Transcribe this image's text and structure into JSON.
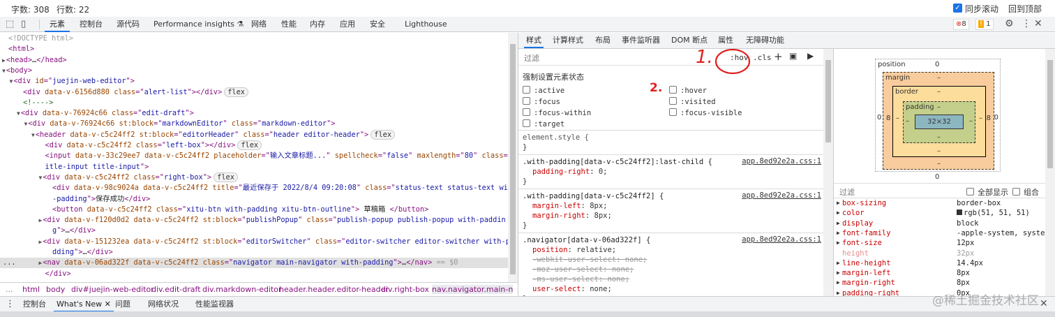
{
  "topbar": {
    "word_count": "字数: 308",
    "line_count": "行数: 22",
    "sync_scroll": "同步滚动",
    "sync_checked": true,
    "back_to_top": "回到顶部"
  },
  "devtools": {
    "tabs": [
      "元素",
      "控制台",
      "源代码",
      "Performance insights",
      "网络",
      "性能",
      "内存",
      "应用",
      "安全",
      "Lighthouse"
    ],
    "active_tab": "元素",
    "errors": "8",
    "warnings": "1",
    "accent": "#1a73e8"
  },
  "elements": {
    "lines": [
      [
        [
          "dt",
          "<!DOCTYPE html>"
        ]
      ],
      [
        [
          "tag",
          "<html>"
        ]
      ],
      [
        [
          "tri",
          "▶"
        ],
        [
          "tag",
          "<head>"
        ],
        [
          "tx",
          "…"
        ],
        [
          "tag",
          "</head>"
        ]
      ],
      [
        [
          "tri",
          "▼"
        ],
        [
          "tag",
          "<body>"
        ]
      ],
      [
        [
          "tri",
          "▼"
        ],
        [
          "tag",
          "<div "
        ],
        [
          "an",
          "id"
        ],
        [
          "tag",
          "=\""
        ],
        [
          "av",
          "juejin-web-editor"
        ],
        [
          "tag",
          "\">"
        ]
      ],
      [
        [
          "tag",
          "<div "
        ],
        [
          "an",
          "data-v-6156d880 class"
        ],
        [
          "tag",
          "=\""
        ],
        [
          "av",
          "alert-list"
        ],
        [
          "tag",
          "\"></div>"
        ],
        [
          "badge",
          "flex"
        ]
      ],
      [
        [
          "cm",
          "<!---->"
        ]
      ],
      [
        [
          "tri",
          "▼"
        ],
        [
          "tag",
          "<div "
        ],
        [
          "an",
          "data-v-76924c66 class"
        ],
        [
          "tag",
          "=\""
        ],
        [
          "av",
          "edit-draft"
        ],
        [
          "tag",
          "\">"
        ]
      ],
      [
        [
          "tri",
          "▼"
        ],
        [
          "tag",
          "<div "
        ],
        [
          "an",
          "data-v-76924c66 st:block"
        ],
        [
          "tag",
          "=\""
        ],
        [
          "av",
          "markdownEditor"
        ],
        [
          "tag",
          "\" "
        ],
        [
          "an",
          "class"
        ],
        [
          "tag",
          "=\""
        ],
        [
          "av",
          "markdown-editor"
        ],
        [
          "tag",
          "\">"
        ]
      ],
      [
        [
          "tri",
          "▼"
        ],
        [
          "tag",
          "<header "
        ],
        [
          "an",
          "data-v-c5c24ff2 st:block"
        ],
        [
          "tag",
          "=\""
        ],
        [
          "av",
          "editorHeader"
        ],
        [
          "tag",
          "\" "
        ],
        [
          "an",
          "class"
        ],
        [
          "tag",
          "=\""
        ],
        [
          "av",
          "header editor-header"
        ],
        [
          "tag",
          "\">"
        ],
        [
          "badge",
          "flex"
        ]
      ],
      [
        [
          "tag",
          "<div "
        ],
        [
          "an",
          "data-v-c5c24ff2 class"
        ],
        [
          "tag",
          "=\""
        ],
        [
          "av",
          "left-box"
        ],
        [
          "tag",
          "\"></div>"
        ],
        [
          "badge",
          "flex"
        ]
      ],
      [
        [
          "tag",
          "<input "
        ],
        [
          "an",
          "data-v-33c29ee7 data-v-c5c24ff2 placeholder"
        ],
        [
          "tag",
          "=\""
        ],
        [
          "av",
          "输入文章标题..."
        ],
        [
          "tag",
          "\" "
        ],
        [
          "an",
          "spellcheck"
        ],
        [
          "tag",
          "=\""
        ],
        [
          "av",
          "false"
        ],
        [
          "tag",
          "\" "
        ],
        [
          "an",
          "maxlength"
        ],
        [
          "tag",
          "=\""
        ],
        [
          "av",
          "80"
        ],
        [
          "tag",
          "\" "
        ],
        [
          "an",
          "class"
        ],
        [
          "tag",
          "=\""
        ],
        [
          "av",
          "t"
        ]
      ],
      [
        [
          "av",
          "itle-input title-input"
        ],
        [
          "tag",
          "\">"
        ]
      ],
      [
        [
          "tri",
          "▼"
        ],
        [
          "tag",
          "<div "
        ],
        [
          "an",
          "data-v-c5c24ff2 class"
        ],
        [
          "tag",
          "=\""
        ],
        [
          "av",
          "right-box"
        ],
        [
          "tag",
          "\">"
        ],
        [
          "badge",
          "flex"
        ]
      ],
      [
        [
          "tag",
          "<div "
        ],
        [
          "an",
          "data-v-98c9024a data-v-c5c24ff2 title"
        ],
        [
          "tag",
          "=\""
        ],
        [
          "av",
          "最近保存于 2022/8/4 09:20:08"
        ],
        [
          "tag",
          "\" "
        ],
        [
          "an",
          "class"
        ],
        [
          "tag",
          "=\""
        ],
        [
          "av",
          "status-text status-text with"
        ]
      ],
      [
        [
          "av",
          "-padding"
        ],
        [
          "tag",
          "\">"
        ],
        [
          "tx",
          "保存成功"
        ],
        [
          "tag",
          "</div>"
        ]
      ],
      [
        [
          "tag",
          "<button "
        ],
        [
          "an",
          "data-v-c5c24ff2 class"
        ],
        [
          "tag",
          "=\""
        ],
        [
          "av",
          "xitu-btn with-padding xitu-btn-outline"
        ],
        [
          "tag",
          "\">"
        ],
        [
          "tx",
          " 草稿箱 "
        ],
        [
          "tag",
          "</button>"
        ]
      ],
      [
        [
          "tri",
          "▶"
        ],
        [
          "tag",
          "<div "
        ],
        [
          "an",
          "data-v-f120d0d2 data-v-c5c24ff2 st:block"
        ],
        [
          "tag",
          "=\""
        ],
        [
          "av",
          "publishPopup"
        ],
        [
          "tag",
          "\" "
        ],
        [
          "an",
          "class"
        ],
        [
          "tag",
          "=\""
        ],
        [
          "av",
          "publish-popup publish-popup with-paddin"
        ]
      ],
      [
        [
          "av",
          "g"
        ],
        [
          "tag",
          "\">"
        ],
        [
          "tx",
          "…"
        ],
        [
          "tag",
          "</div>"
        ]
      ],
      [
        [
          "tri",
          "▶"
        ],
        [
          "tag",
          "<div "
        ],
        [
          "an",
          "data-v-151232ea data-v-c5c24ff2 st:block"
        ],
        [
          "tag",
          "=\""
        ],
        [
          "av",
          "editorSwitcher"
        ],
        [
          "tag",
          "\" "
        ],
        [
          "an",
          "class"
        ],
        [
          "tag",
          "=\""
        ],
        [
          "av",
          "editor-switcher editor-switcher with-pa"
        ]
      ],
      [
        [
          "av",
          "dding"
        ],
        [
          "tag",
          "\">"
        ],
        [
          "tx",
          "…"
        ],
        [
          "tag",
          "</div>"
        ]
      ],
      [
        [
          "tri",
          "▶"
        ],
        [
          "tag",
          "<nav "
        ],
        [
          "an",
          "data-v-06ad322f data-v-c5c24ff2 class"
        ],
        [
          "tag",
          "=\""
        ],
        [
          "av",
          "navigator main-navigator with-padding"
        ],
        [
          "tag",
          "\">"
        ],
        [
          "tx",
          "…"
        ],
        [
          "tag",
          "</nav>"
        ],
        [
          "dt",
          " == $0"
        ]
      ],
      [
        [
          "tag",
          "</div>"
        ]
      ]
    ],
    "selected_marker": "..."
  },
  "breadcrumbs": [
    "...",
    "html",
    "body",
    "div#juejin-web-editor",
    "div.edit-draft",
    "div.markdown-editor",
    "header.header.editor-header",
    "div.right-box",
    "nav.navigator.main-n"
  ],
  "drawer": {
    "tabs": [
      "控制台",
      "What's New",
      "问题",
      "网络状况",
      "性能监视器"
    ],
    "active": "What's New"
  },
  "styles": {
    "tabs": [
      "样式",
      "计算样式",
      "布局",
      "事件监听器",
      "DOM 断点",
      "属性",
      "无障碍功能"
    ],
    "filter_placeholder": "过滤",
    "hov": ":hov",
    "cls": ".cls",
    "force_state_title": "强制设置元素状态",
    "states_left": [
      ":active",
      ":focus",
      ":focus-within",
      ":target"
    ],
    "states_right": [
      ":hover",
      ":visited",
      ":focus-visible"
    ],
    "rules": [
      {
        "selector": "element.style {",
        "source": "",
        "props": []
      },
      {
        "selector": ".with-padding[data-v-c5c24ff2]:last-child {",
        "source": "app.8ed92e2a.css:1",
        "props": [
          {
            "name": "padding-right",
            "value": "0;",
            "struck": false
          }
        ]
      },
      {
        "selector": ".with-padding[data-v-c5c24ff2] {",
        "source": "app.8ed92e2a.css:1",
        "props": [
          {
            "name": "margin-left",
            "value": "8px;",
            "struck": false
          },
          {
            "name": "margin-right",
            "value": "8px;",
            "struck": false
          }
        ]
      },
      {
        "selector": ".navigator[data-v-06ad322f] {",
        "source": "app.8ed92e2a.css:1",
        "props": [
          {
            "name": "position",
            "value": "relative;",
            "struck": false
          },
          {
            "name": "-webkit-user-select",
            "value": "none;",
            "struck": true
          },
          {
            "name": "-moz-user-select",
            "value": "none;",
            "struck": true
          },
          {
            "name": "-ms-user-select",
            "value": "none;",
            "struck": true
          },
          {
            "name": "user-select",
            "value": "none;",
            "struck": false
          }
        ]
      }
    ],
    "close_brace": "}"
  },
  "annotations": {
    "step1": "1.",
    "step2": "2.",
    "color": "#e02020"
  },
  "box_model": {
    "position_label": "position",
    "position": "0",
    "margin_label": "margin",
    "margin_top": "–",
    "margin_bottom": "–",
    "margin_left": "8",
    "margin_right": "8",
    "border_label": "border",
    "border_top": "–",
    "border_bottom": "–",
    "border_left": "–",
    "border_right": "–",
    "padding_label": "padding",
    "padding_top": "–",
    "padding_bottom": "–",
    "padding_left": "–",
    "padding_right": "–",
    "content": "32×32",
    "pos_left": "0",
    "pos_right": "0",
    "pos_bottom": "0"
  },
  "computed": {
    "filter_placeholder": "过滤",
    "show_all": "全部显示",
    "group": "组合",
    "props": [
      {
        "name": "box-sizing",
        "value": "border-box"
      },
      {
        "name": "color",
        "value": "rgb(51, 51, 51)",
        "swatch": "#333333"
      },
      {
        "name": "display",
        "value": "block"
      },
      {
        "name": "font-family",
        "value": "-apple-system, system-"
      },
      {
        "name": "font-size",
        "value": "12px"
      },
      {
        "name": "height",
        "value": "32px",
        "inherited": true
      },
      {
        "name": "line-height",
        "value": "14.4px"
      },
      {
        "name": "margin-left",
        "value": "8px"
      },
      {
        "name": "margin-right",
        "value": "8px"
      },
      {
        "name": "padding-right",
        "value": "0px"
      }
    ]
  },
  "watermark": "@稀土掘金技术社区"
}
